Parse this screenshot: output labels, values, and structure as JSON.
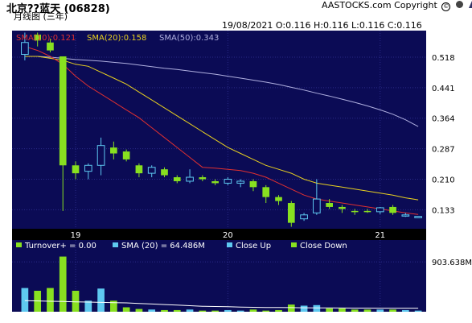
{
  "header": {
    "title": "北京??蓝天 (06828)",
    "subtitle": "月线图 (三年)",
    "copyright": "AASTOCKS.com Copyright",
    "ohlc": "19/08/2021   O:0.116  H:0.116  L:0.116  C:0.116"
  },
  "colors": {
    "background": "#0b0b55",
    "grid": "#2a2a88",
    "up": "#5ec8f0",
    "down": "#88e020",
    "sma10": "#e03030",
    "sma20": "#e8d020",
    "sma50": "#b0b0e0",
    "volume_sma": "#ffffff"
  },
  "chart_data": [
    {
      "type": "candlestick",
      "legend": [
        {
          "label": "SMA(10):0.121",
          "color": "#e03030"
        },
        {
          "label": "SMA(20):0.158",
          "color": "#e8d020"
        },
        {
          "label": "SMA(50):0.343",
          "color": "#b0b0e0"
        }
      ],
      "y_ticks": [
        0.518,
        0.441,
        0.364,
        0.287,
        0.21,
        0.133
      ],
      "ylim": [
        0.085,
        0.585
      ],
      "x_ticks": [
        {
          "label": "19",
          "index": 4
        },
        {
          "label": "20",
          "index": 16
        },
        {
          "label": "21",
          "index": 28
        }
      ],
      "candles": [
        {
          "o": 0.525,
          "h": 0.58,
          "l": 0.51,
          "c": 0.555,
          "dir": "up"
        },
        {
          "o": 0.575,
          "h": 0.58,
          "l": 0.545,
          "c": 0.56,
          "dir": "down"
        },
        {
          "o": 0.555,
          "h": 0.565,
          "l": 0.53,
          "c": 0.535,
          "dir": "down"
        },
        {
          "o": 0.52,
          "h": 0.52,
          "l": 0.13,
          "c": 0.245,
          "dir": "down"
        },
        {
          "o": 0.245,
          "h": 0.255,
          "l": 0.21,
          "c": 0.225,
          "dir": "down"
        },
        {
          "o": 0.23,
          "h": 0.25,
          "l": 0.21,
          "c": 0.245,
          "dir": "up"
        },
        {
          "o": 0.245,
          "h": 0.315,
          "l": 0.22,
          "c": 0.295,
          "dir": "up"
        },
        {
          "o": 0.29,
          "h": 0.305,
          "l": 0.26,
          "c": 0.275,
          "dir": "down"
        },
        {
          "o": 0.28,
          "h": 0.285,
          "l": 0.255,
          "c": 0.26,
          "dir": "down"
        },
        {
          "o": 0.245,
          "h": 0.25,
          "l": 0.215,
          "c": 0.225,
          "dir": "down"
        },
        {
          "o": 0.225,
          "h": 0.245,
          "l": 0.215,
          "c": 0.24,
          "dir": "up"
        },
        {
          "o": 0.235,
          "h": 0.24,
          "l": 0.215,
          "c": 0.22,
          "dir": "down"
        },
        {
          "o": 0.215,
          "h": 0.22,
          "l": 0.2,
          "c": 0.205,
          "dir": "down"
        },
        {
          "o": 0.205,
          "h": 0.235,
          "l": 0.2,
          "c": 0.215,
          "dir": "up"
        },
        {
          "o": 0.215,
          "h": 0.22,
          "l": 0.205,
          "c": 0.21,
          "dir": "down"
        },
        {
          "o": 0.205,
          "h": 0.21,
          "l": 0.195,
          "c": 0.2,
          "dir": "down"
        },
        {
          "o": 0.2,
          "h": 0.215,
          "l": 0.195,
          "c": 0.21,
          "dir": "up"
        },
        {
          "o": 0.205,
          "h": 0.21,
          "l": 0.19,
          "c": 0.2,
          "dir": "up"
        },
        {
          "o": 0.205,
          "h": 0.21,
          "l": 0.18,
          "c": 0.19,
          "dir": "down"
        },
        {
          "o": 0.19,
          "h": 0.195,
          "l": 0.15,
          "c": 0.165,
          "dir": "down"
        },
        {
          "o": 0.165,
          "h": 0.17,
          "l": 0.145,
          "c": 0.155,
          "dir": "down"
        },
        {
          "o": 0.15,
          "h": 0.155,
          "l": 0.09,
          "c": 0.1,
          "dir": "down"
        },
        {
          "o": 0.11,
          "h": 0.125,
          "l": 0.105,
          "c": 0.12,
          "dir": "up"
        },
        {
          "o": 0.125,
          "h": 0.21,
          "l": 0.12,
          "c": 0.16,
          "dir": "up"
        },
        {
          "o": 0.15,
          "h": 0.16,
          "l": 0.135,
          "c": 0.14,
          "dir": "down"
        },
        {
          "o": 0.14,
          "h": 0.145,
          "l": 0.125,
          "c": 0.135,
          "dir": "down"
        },
        {
          "o": 0.13,
          "h": 0.135,
          "l": 0.12,
          "c": 0.127,
          "dir": "down"
        },
        {
          "o": 0.13,
          "h": 0.135,
          "l": 0.125,
          "c": 0.13,
          "dir": "down"
        },
        {
          "o": 0.128,
          "h": 0.14,
          "l": 0.122,
          "c": 0.138,
          "dir": "up"
        },
        {
          "o": 0.14,
          "h": 0.145,
          "l": 0.12,
          "c": 0.125,
          "dir": "down"
        },
        {
          "o": 0.12,
          "h": 0.125,
          "l": 0.115,
          "c": 0.118,
          "dir": "up"
        },
        {
          "o": 0.116,
          "h": 0.116,
          "l": 0.116,
          "c": 0.116,
          "dir": "up"
        }
      ],
      "sma10": [
        0.545,
        0.535,
        0.52,
        0.5,
        0.47,
        0.445,
        0.425,
        0.405,
        0.385,
        0.365,
        0.34,
        0.315,
        0.29,
        0.265,
        0.24,
        0.238,
        0.235,
        0.232,
        0.225,
        0.215,
        0.2,
        0.185,
        0.17,
        0.16,
        0.155,
        0.15,
        0.145,
        0.14,
        0.135,
        0.13,
        0.125,
        0.121
      ],
      "sma20": [
        0.52,
        0.52,
        0.515,
        0.51,
        0.5,
        0.495,
        0.48,
        0.465,
        0.45,
        0.43,
        0.41,
        0.39,
        0.37,
        0.35,
        0.33,
        0.31,
        0.29,
        0.275,
        0.26,
        0.245,
        0.235,
        0.225,
        0.21,
        0.2,
        0.195,
        0.19,
        0.185,
        0.18,
        0.175,
        0.17,
        0.163,
        0.158
      ],
      "sma50": [
        0.52,
        0.52,
        0.518,
        0.515,
        0.512,
        0.51,
        0.508,
        0.505,
        0.502,
        0.498,
        0.494,
        0.49,
        0.487,
        0.483,
        0.479,
        0.475,
        0.47,
        0.465,
        0.46,
        0.455,
        0.449,
        0.442,
        0.435,
        0.427,
        0.42,
        0.412,
        0.404,
        0.395,
        0.385,
        0.374,
        0.36,
        0.343
      ]
    },
    {
      "type": "bar",
      "legend": [
        {
          "label": "Turnover+ = 0.00",
          "color": "#88e020"
        },
        {
          "label": "SMA (20) = 64.486M",
          "color": "#5ec8f0"
        },
        {
          "label": "Close Up",
          "color": "#5ec8f0"
        },
        {
          "label": "Close Down",
          "color": "#88e020"
        }
      ],
      "y_ticks": [
        "903.638M"
      ],
      "y_tick_value": 903.638,
      "ylim": [
        0,
        1300
      ],
      "volumes": [
        430,
        380,
        430,
        1000,
        380,
        200,
        420,
        200,
        80,
        50,
        40,
        30,
        30,
        40,
        20,
        20,
        30,
        20,
        40,
        20,
        30,
        130,
        110,
        120,
        60,
        60,
        40,
        40,
        40,
        40,
        30,
        20
      ],
      "sma": [
        200,
        195,
        190,
        185,
        180,
        175,
        170,
        165,
        160,
        150,
        140,
        130,
        120,
        110,
        100,
        95,
        90,
        85,
        80,
        78,
        76,
        74,
        72,
        70,
        68,
        67,
        66,
        66,
        65,
        65,
        64.5,
        64.486
      ]
    }
  ]
}
